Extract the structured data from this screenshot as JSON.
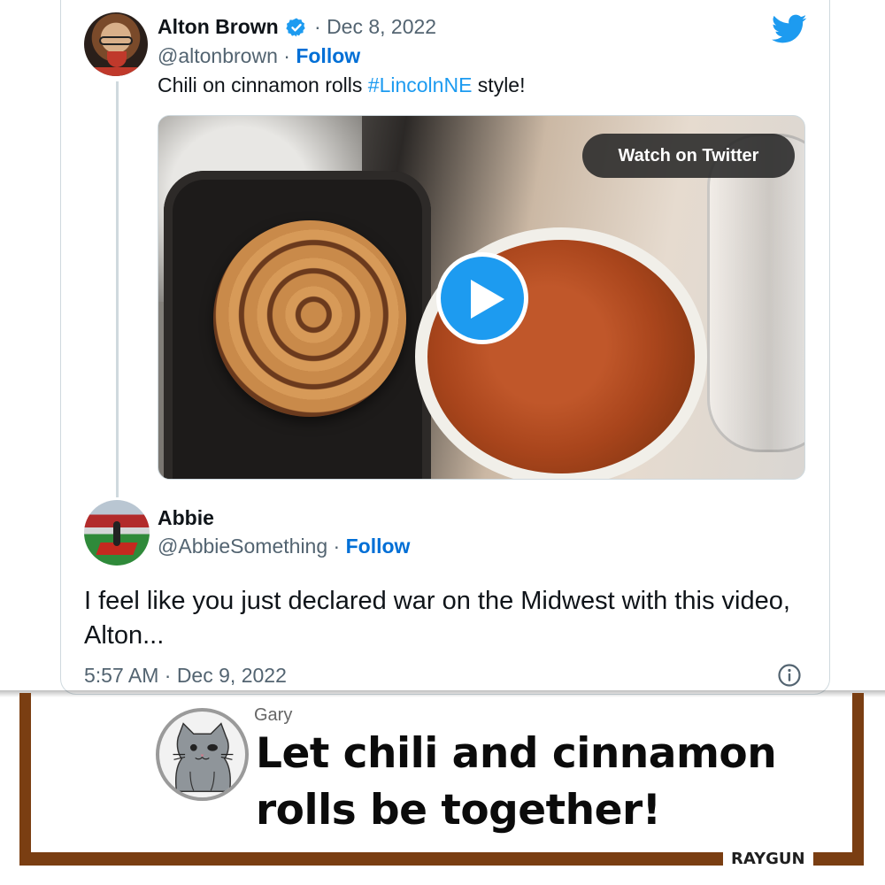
{
  "tweet": {
    "author_name": "Alton Brown",
    "verified_icon": "verified-badge-icon",
    "separator": "·",
    "date": "Dec 8, 2022",
    "handle": "@altonbrown",
    "follow_label": "Follow",
    "text_before": "Chili on cinnamon rolls ",
    "hashtag": "#LincolnNE",
    "text_after": " style!",
    "brand_icon": "twitter-bird-icon",
    "video": {
      "watch_label": "Watch on Twitter",
      "play_icon": "play-icon"
    }
  },
  "reply": {
    "author_name": "Abbie",
    "handle": "@AbbieSomething",
    "follow_label": "Follow",
    "text": "I feel like you just declared war on the Midwest with this video, Alton...",
    "timestamp": "5:57 AM · Dec 9, 2022",
    "info_icon": "info-icon"
  },
  "caption": {
    "author": "Gary",
    "headline": "Let chili and cinnamon rolls be together!",
    "brand": "RAYGUN"
  },
  "colors": {
    "twitter_blue": "#1d9bf0",
    "follow_blue": "#006fd6",
    "frame_brown": "#7a3e12",
    "secondary_text": "#536471"
  }
}
